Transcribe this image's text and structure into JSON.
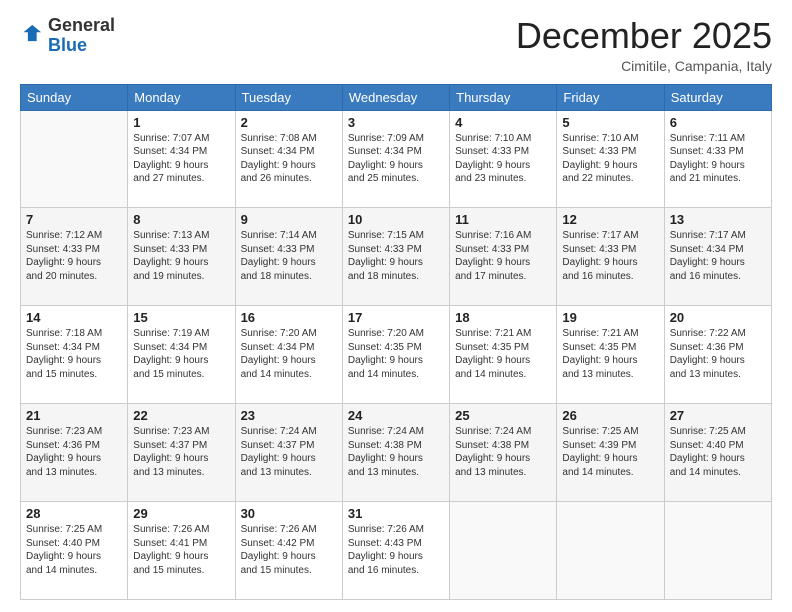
{
  "header": {
    "logo_general": "General",
    "logo_blue": "Blue",
    "month_title": "December 2025",
    "location": "Cimitile, Campania, Italy"
  },
  "days_of_week": [
    "Sunday",
    "Monday",
    "Tuesday",
    "Wednesday",
    "Thursday",
    "Friday",
    "Saturday"
  ],
  "weeks": [
    [
      {
        "num": "",
        "info": ""
      },
      {
        "num": "1",
        "info": "Sunrise: 7:07 AM\nSunset: 4:34 PM\nDaylight: 9 hours\nand 27 minutes."
      },
      {
        "num": "2",
        "info": "Sunrise: 7:08 AM\nSunset: 4:34 PM\nDaylight: 9 hours\nand 26 minutes."
      },
      {
        "num": "3",
        "info": "Sunrise: 7:09 AM\nSunset: 4:34 PM\nDaylight: 9 hours\nand 25 minutes."
      },
      {
        "num": "4",
        "info": "Sunrise: 7:10 AM\nSunset: 4:33 PM\nDaylight: 9 hours\nand 23 minutes."
      },
      {
        "num": "5",
        "info": "Sunrise: 7:10 AM\nSunset: 4:33 PM\nDaylight: 9 hours\nand 22 minutes."
      },
      {
        "num": "6",
        "info": "Sunrise: 7:11 AM\nSunset: 4:33 PM\nDaylight: 9 hours\nand 21 minutes."
      }
    ],
    [
      {
        "num": "7",
        "info": "Sunrise: 7:12 AM\nSunset: 4:33 PM\nDaylight: 9 hours\nand 20 minutes."
      },
      {
        "num": "8",
        "info": "Sunrise: 7:13 AM\nSunset: 4:33 PM\nDaylight: 9 hours\nand 19 minutes."
      },
      {
        "num": "9",
        "info": "Sunrise: 7:14 AM\nSunset: 4:33 PM\nDaylight: 9 hours\nand 18 minutes."
      },
      {
        "num": "10",
        "info": "Sunrise: 7:15 AM\nSunset: 4:33 PM\nDaylight: 9 hours\nand 18 minutes."
      },
      {
        "num": "11",
        "info": "Sunrise: 7:16 AM\nSunset: 4:33 PM\nDaylight: 9 hours\nand 17 minutes."
      },
      {
        "num": "12",
        "info": "Sunrise: 7:17 AM\nSunset: 4:33 PM\nDaylight: 9 hours\nand 16 minutes."
      },
      {
        "num": "13",
        "info": "Sunrise: 7:17 AM\nSunset: 4:34 PM\nDaylight: 9 hours\nand 16 minutes."
      }
    ],
    [
      {
        "num": "14",
        "info": "Sunrise: 7:18 AM\nSunset: 4:34 PM\nDaylight: 9 hours\nand 15 minutes."
      },
      {
        "num": "15",
        "info": "Sunrise: 7:19 AM\nSunset: 4:34 PM\nDaylight: 9 hours\nand 15 minutes."
      },
      {
        "num": "16",
        "info": "Sunrise: 7:20 AM\nSunset: 4:34 PM\nDaylight: 9 hours\nand 14 minutes."
      },
      {
        "num": "17",
        "info": "Sunrise: 7:20 AM\nSunset: 4:35 PM\nDaylight: 9 hours\nand 14 minutes."
      },
      {
        "num": "18",
        "info": "Sunrise: 7:21 AM\nSunset: 4:35 PM\nDaylight: 9 hours\nand 14 minutes."
      },
      {
        "num": "19",
        "info": "Sunrise: 7:21 AM\nSunset: 4:35 PM\nDaylight: 9 hours\nand 13 minutes."
      },
      {
        "num": "20",
        "info": "Sunrise: 7:22 AM\nSunset: 4:36 PM\nDaylight: 9 hours\nand 13 minutes."
      }
    ],
    [
      {
        "num": "21",
        "info": "Sunrise: 7:23 AM\nSunset: 4:36 PM\nDaylight: 9 hours\nand 13 minutes."
      },
      {
        "num": "22",
        "info": "Sunrise: 7:23 AM\nSunset: 4:37 PM\nDaylight: 9 hours\nand 13 minutes."
      },
      {
        "num": "23",
        "info": "Sunrise: 7:24 AM\nSunset: 4:37 PM\nDaylight: 9 hours\nand 13 minutes."
      },
      {
        "num": "24",
        "info": "Sunrise: 7:24 AM\nSunset: 4:38 PM\nDaylight: 9 hours\nand 13 minutes."
      },
      {
        "num": "25",
        "info": "Sunrise: 7:24 AM\nSunset: 4:38 PM\nDaylight: 9 hours\nand 13 minutes."
      },
      {
        "num": "26",
        "info": "Sunrise: 7:25 AM\nSunset: 4:39 PM\nDaylight: 9 hours\nand 14 minutes."
      },
      {
        "num": "27",
        "info": "Sunrise: 7:25 AM\nSunset: 4:40 PM\nDaylight: 9 hours\nand 14 minutes."
      }
    ],
    [
      {
        "num": "28",
        "info": "Sunrise: 7:25 AM\nSunset: 4:40 PM\nDaylight: 9 hours\nand 14 minutes."
      },
      {
        "num": "29",
        "info": "Sunrise: 7:26 AM\nSunset: 4:41 PM\nDaylight: 9 hours\nand 15 minutes."
      },
      {
        "num": "30",
        "info": "Sunrise: 7:26 AM\nSunset: 4:42 PM\nDaylight: 9 hours\nand 15 minutes."
      },
      {
        "num": "31",
        "info": "Sunrise: 7:26 AM\nSunset: 4:43 PM\nDaylight: 9 hours\nand 16 minutes."
      },
      {
        "num": "",
        "info": ""
      },
      {
        "num": "",
        "info": ""
      },
      {
        "num": "",
        "info": ""
      }
    ]
  ]
}
